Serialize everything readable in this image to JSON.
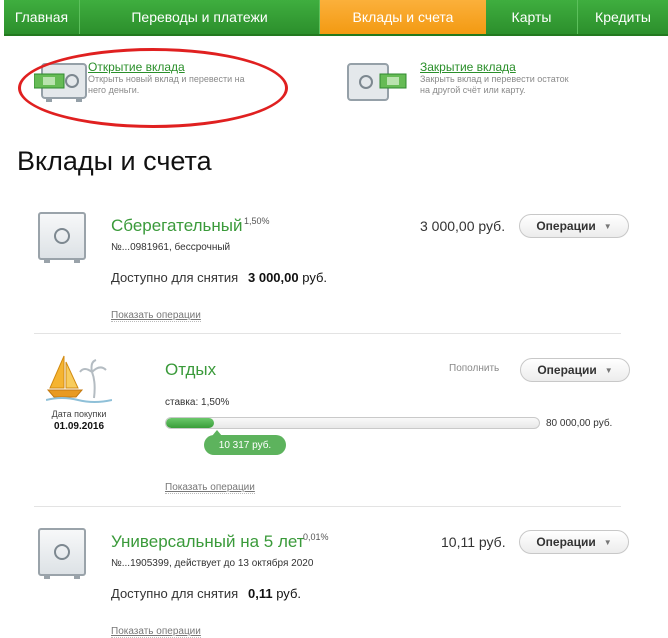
{
  "nav": {
    "tabs": [
      {
        "label": "Главная"
      },
      {
        "label": "Переводы и платежи"
      },
      {
        "label": "Вклады и счета"
      },
      {
        "label": "Карты"
      },
      {
        "label": "Кредиты"
      }
    ],
    "active_index": 2
  },
  "quick_actions": {
    "open": {
      "title": "Открытие вклада",
      "desc": "Открыть новый вклад и перевести на него деньги."
    },
    "close": {
      "title": "Закрытие вклада",
      "desc": "Закрыть вклад и перевести остаток на другой счёт или карту."
    }
  },
  "page_title": "Вклады и счета",
  "accounts": [
    {
      "name": "Сберегательный",
      "rate": "1,50%",
      "number": "№...0981961, бессрочный",
      "amount": "3 000,00 руб.",
      "available_label": "Доступно для снятия",
      "available_value": "3 000,00",
      "available_currency": "руб.",
      "ops_label": "Операции",
      "show_ops": "Показать операции"
    },
    {
      "name": "Универсальный на 5 лет",
      "rate": "0,01%",
      "number": "№...1905399, действует до 13 октября 2020",
      "amount": "10,11 руб.",
      "available_label": "Доступно для снятия",
      "available_value": "0,11",
      "available_currency": "руб.",
      "ops_label": "Операции",
      "show_ops": "Показать операции"
    }
  ],
  "goal": {
    "name": "Отдых",
    "date_label": "Дата покупки",
    "date": "01.09.2016",
    "rate_text": "ставка: 1,50%",
    "current": "10 317 руб.",
    "target": "80 000,00 руб.",
    "progress_fraction": 0.129,
    "topup_label": "Пополнить",
    "ops_label": "Операции",
    "show_ops": "Показать операции"
  },
  "colors": {
    "green": "#3a9a3a",
    "active_tab": "#f39a12",
    "red_highlight": "#e02020"
  }
}
